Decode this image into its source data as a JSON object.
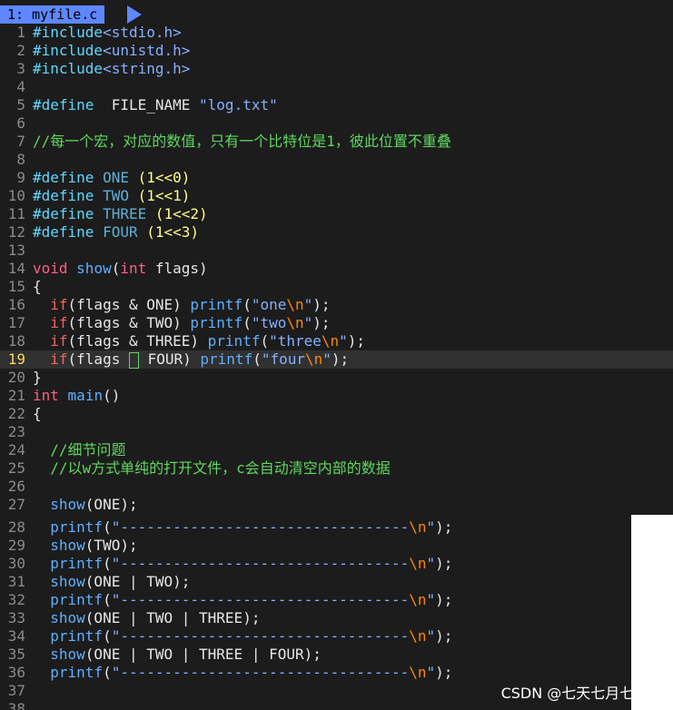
{
  "editor": {
    "tab_label": "1: myfile.c",
    "cursor_line": 19,
    "watermark": "CSDN @七天七月七年_J"
  },
  "lines_top": [
    {
      "n": "1",
      "parts": [
        [
          "pp",
          "#include"
        ],
        [
          "hdr",
          "<stdio.h>"
        ]
      ]
    },
    {
      "n": "2",
      "parts": [
        [
          "pp",
          "#include"
        ],
        [
          "hdr",
          "<unistd.h>"
        ]
      ]
    },
    {
      "n": "3",
      "parts": [
        [
          "pp",
          "#include"
        ],
        [
          "hdr",
          "<string.h>"
        ]
      ]
    },
    {
      "n": "4",
      "parts": []
    },
    {
      "n": "5",
      "parts": [
        [
          "pp",
          "#define"
        ],
        [
          "",
          "  FILE_NAME "
        ],
        [
          "str",
          "\"log.txt\""
        ]
      ]
    },
    {
      "n": "6",
      "parts": []
    },
    {
      "n": "7",
      "parts": [
        [
          "cmt",
          "//每一个宏，对应的数值，只有一个比特位是1，彼此位置不重叠"
        ]
      ]
    },
    {
      "n": "8",
      "parts": []
    },
    {
      "n": "9",
      "parts": [
        [
          "pp",
          "#define"
        ],
        [
          "",
          " "
        ],
        [
          "mac",
          "ONE"
        ],
        [
          "",
          " "
        ],
        [
          "numl",
          "(1<<0)"
        ]
      ]
    },
    {
      "n": "10",
      "parts": [
        [
          "pp",
          "#define"
        ],
        [
          "",
          " "
        ],
        [
          "mac",
          "TWO"
        ],
        [
          "",
          " "
        ],
        [
          "numl",
          "(1<<1)"
        ]
      ]
    },
    {
      "n": "11",
      "parts": [
        [
          "pp",
          "#define"
        ],
        [
          "",
          " "
        ],
        [
          "mac",
          "THREE"
        ],
        [
          "",
          " "
        ],
        [
          "numl",
          "(1<<2)"
        ]
      ]
    },
    {
      "n": "12",
      "parts": [
        [
          "pp",
          "#define"
        ],
        [
          "",
          " "
        ],
        [
          "mac",
          "FOUR"
        ],
        [
          "",
          " "
        ],
        [
          "numl",
          "(1<<3)"
        ]
      ]
    },
    {
      "n": "13",
      "parts": []
    },
    {
      "n": "14",
      "parts": [
        [
          "ty",
          "void"
        ],
        [
          "",
          " "
        ],
        [
          "fn",
          "show"
        ],
        [
          "",
          "("
        ],
        [
          "ty",
          "int"
        ],
        [
          "",
          " flags)"
        ]
      ]
    },
    {
      "n": "15",
      "parts": [
        [
          "",
          "{"
        ]
      ]
    },
    {
      "n": "16",
      "parts": [
        [
          "kw",
          "  if"
        ],
        [
          "",
          "(flags & ONE) "
        ],
        [
          "fn",
          "printf"
        ],
        [
          "",
          "("
        ],
        [
          "str",
          "\"one"
        ],
        [
          "esc",
          "\\n"
        ],
        [
          "str",
          "\""
        ],
        [
          "",
          ");"
        ]
      ]
    },
    {
      "n": "17",
      "parts": [
        [
          "kw",
          "  if"
        ],
        [
          "",
          "(flags & TWO) "
        ],
        [
          "fn",
          "printf"
        ],
        [
          "",
          "("
        ],
        [
          "str",
          "\"two"
        ],
        [
          "esc",
          "\\n"
        ],
        [
          "str",
          "\""
        ],
        [
          "",
          ");"
        ]
      ]
    },
    {
      "n": "18",
      "parts": [
        [
          "kw",
          "  if"
        ],
        [
          "",
          "(flags & THREE) "
        ],
        [
          "fn",
          "printf"
        ],
        [
          "",
          "("
        ],
        [
          "str",
          "\"three"
        ],
        [
          "esc",
          "\\n"
        ],
        [
          "str",
          "\""
        ],
        [
          "",
          ");"
        ]
      ]
    },
    {
      "n": "19",
      "parts": [
        [
          "kw",
          "  if"
        ],
        [
          "",
          "(flags "
        ],
        [
          "cursor",
          ""
        ],
        [
          "",
          " FOUR) "
        ],
        [
          "fn",
          "printf"
        ],
        [
          "",
          "("
        ],
        [
          "str",
          "\"four"
        ],
        [
          "esc",
          "\\n"
        ],
        [
          "str",
          "\""
        ],
        [
          "",
          ");"
        ]
      ]
    },
    {
      "n": "20",
      "parts": [
        [
          "",
          "}"
        ]
      ]
    },
    {
      "n": "21",
      "parts": [
        [
          "ty",
          "int"
        ],
        [
          "",
          " "
        ],
        [
          "fn",
          "main"
        ],
        [
          "",
          "()"
        ]
      ]
    },
    {
      "n": "22",
      "parts": [
        [
          "",
          "{"
        ]
      ]
    },
    {
      "n": "23",
      "parts": []
    },
    {
      "n": "24",
      "parts": [
        [
          "cmt",
          "  //细节问题"
        ]
      ]
    },
    {
      "n": "25",
      "parts": [
        [
          "cmt",
          "  //以w方式单纯的打开文件，c会自动清空内部的数据"
        ]
      ]
    },
    {
      "n": "26",
      "parts": []
    },
    {
      "n": "27",
      "parts": [
        [
          "fn",
          "  show"
        ],
        [
          "",
          "(ONE);"
        ]
      ]
    }
  ],
  "lines_bottom": [
    {
      "n": "28",
      "parts": [
        [
          "fn",
          "  printf"
        ],
        [
          "",
          "("
        ],
        [
          "str",
          "\"---------------------------------"
        ],
        [
          "esc",
          "\\n"
        ],
        [
          "str",
          "\""
        ],
        [
          "",
          ");"
        ]
      ]
    },
    {
      "n": "29",
      "parts": [
        [
          "fn",
          "  show"
        ],
        [
          "",
          "(TWO);"
        ]
      ]
    },
    {
      "n": "30",
      "parts": [
        [
          "fn",
          "  printf"
        ],
        [
          "",
          "("
        ],
        [
          "str",
          "\"---------------------------------"
        ],
        [
          "esc",
          "\\n"
        ],
        [
          "str",
          "\""
        ],
        [
          "",
          ");"
        ]
      ]
    },
    {
      "n": "31",
      "parts": [
        [
          "fn",
          "  show"
        ],
        [
          "",
          "(ONE | TWO);"
        ]
      ]
    },
    {
      "n": "32",
      "parts": [
        [
          "fn",
          "  printf"
        ],
        [
          "",
          "("
        ],
        [
          "str",
          "\"---------------------------------"
        ],
        [
          "esc",
          "\\n"
        ],
        [
          "str",
          "\""
        ],
        [
          "",
          ");"
        ]
      ]
    },
    {
      "n": "33",
      "parts": [
        [
          "fn",
          "  show"
        ],
        [
          "",
          "(ONE | TWO | THREE);"
        ]
      ]
    },
    {
      "n": "34",
      "parts": [
        [
          "fn",
          "  printf"
        ],
        [
          "",
          "("
        ],
        [
          "str",
          "\"---------------------------------"
        ],
        [
          "esc",
          "\\n"
        ],
        [
          "str",
          "\""
        ],
        [
          "",
          ");"
        ]
      ]
    },
    {
      "n": "35",
      "parts": [
        [
          "fn",
          "  show"
        ],
        [
          "",
          "(ONE | TWO | THREE | FOUR);"
        ]
      ]
    },
    {
      "n": "36",
      "parts": [
        [
          "fn",
          "  printf"
        ],
        [
          "",
          "("
        ],
        [
          "str",
          "\"---------------------------------"
        ],
        [
          "esc",
          "\\n"
        ],
        [
          "str",
          "\""
        ],
        [
          "",
          ");"
        ]
      ]
    },
    {
      "n": "37",
      "parts": []
    },
    {
      "n": "38",
      "parts": []
    }
  ]
}
